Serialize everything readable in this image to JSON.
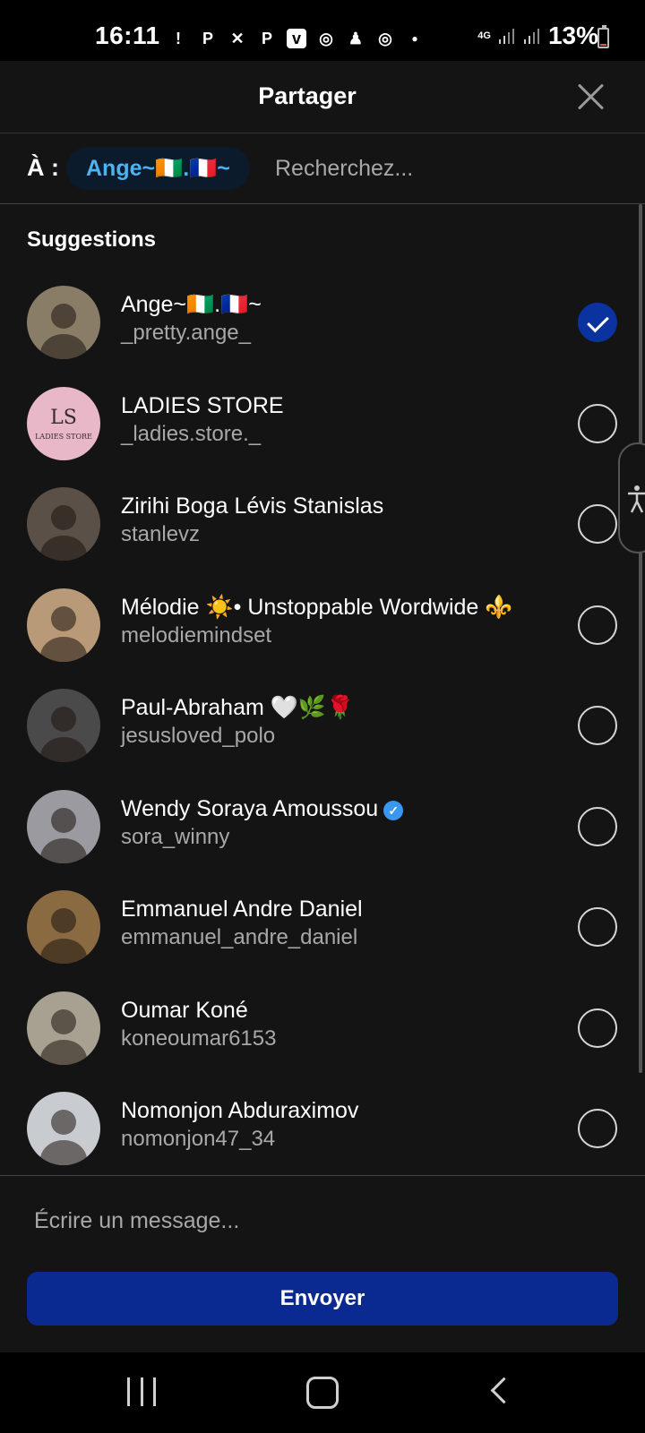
{
  "status_bar": {
    "time": "16:11",
    "network": "4G",
    "battery": "13%",
    "battery_level": 0.13,
    "icons": [
      "alert-icon",
      "p-icon",
      "messenger-icon",
      "p-icon",
      "vinted-icon",
      "instagram-icon",
      "snapchat-icon",
      "instagram-icon",
      "dot-icon"
    ]
  },
  "header": {
    "title": "Partager"
  },
  "to_row": {
    "label": "À :",
    "chip": "Ange~🇨🇮.🇫🇷~",
    "search_placeholder": "Recherchez..."
  },
  "list": {
    "heading": "Suggestions",
    "rows": [
      {
        "name": "Ange~🇨🇮.🇫🇷~",
        "username": "_pretty.ange_",
        "selected": true,
        "avatar_color": "#8a7d68"
      },
      {
        "name": "LADIES STORE",
        "username": "_ladies.store._",
        "selected": false,
        "avatar_color": "#e8b8c8",
        "avatar_text": "LS",
        "avatar_sub": "LADIES STORE"
      },
      {
        "name": "Zirihi Boga Lévis Stanislas",
        "username": "stanlevz",
        "selected": false,
        "avatar_color": "#5a5048"
      },
      {
        "name": "Mélodie ☀️• Unstoppable Wordwide ⚜️",
        "username": "melodiemindset",
        "selected": false,
        "avatar_color": "#b89a78"
      },
      {
        "name": "Paul-Abraham 🤍🌿🌹",
        "username": "jesusloved_polo",
        "selected": false,
        "avatar_color": "#4a4a4a"
      },
      {
        "name": "Wendy Soraya Amoussou",
        "username": "sora_winny",
        "selected": false,
        "verified": true,
        "avatar_color": "#9a9aa0"
      },
      {
        "name": "Emmanuel Andre Daniel",
        "username": "emmanuel_andre_daniel",
        "selected": false,
        "avatar_color": "#8a6a40"
      },
      {
        "name": "Oumar Koné",
        "username": "koneoumar6153",
        "selected": false,
        "avatar_color": "#a8a090"
      },
      {
        "name": "Nomonjon Abduraximov",
        "username": "nomonjon47_34",
        "selected": false,
        "avatar_color": "#c8ccd0"
      }
    ]
  },
  "footer": {
    "message_placeholder": "Écrire un message...",
    "send_label": "Envoyer"
  },
  "colors": {
    "accent": "#0a2a91",
    "chip_text": "#4cb2f0",
    "background": "#141414"
  }
}
